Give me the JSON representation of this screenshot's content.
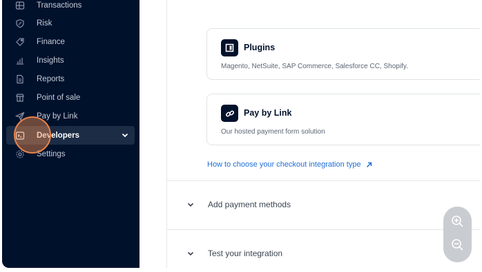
{
  "sidebar": {
    "items": [
      {
        "label": "Transactions",
        "icon": "table-icon"
      },
      {
        "label": "Risk",
        "icon": "shield-icon"
      },
      {
        "label": "Finance",
        "icon": "tag-icon"
      },
      {
        "label": "Insights",
        "icon": "bar-chart-icon"
      },
      {
        "label": "Reports",
        "icon": "document-icon"
      },
      {
        "label": "Point of sale",
        "icon": "store-icon"
      },
      {
        "label": "Pay by Link",
        "icon": "paper-plane-icon"
      },
      {
        "label": "Developers",
        "icon": "terminal-icon",
        "active": true
      },
      {
        "label": "Settings",
        "icon": "gear-icon"
      }
    ]
  },
  "main": {
    "plugins_card": {
      "title": "Plugins",
      "description": "Magento, NetSuite, SAP Commerce, Salesforce CC, Shopify."
    },
    "pay_by_link_card": {
      "title": "Pay by Link",
      "description": "Our hosted payment form solution"
    },
    "help_link": "How to choose your checkout integration type",
    "sections": [
      {
        "label": "Add payment methods"
      },
      {
        "label": "Test your integration"
      }
    ]
  },
  "zoom": {
    "zoom_in_icon": "zoom-in-icon",
    "zoom_out_icon": "zoom-out-icon"
  },
  "colors": {
    "sidebar_bg": "#00112c",
    "active_item_bg": "#1c2c45",
    "link": "#1f6fd6",
    "cursor_highlight": "#e8824a"
  }
}
